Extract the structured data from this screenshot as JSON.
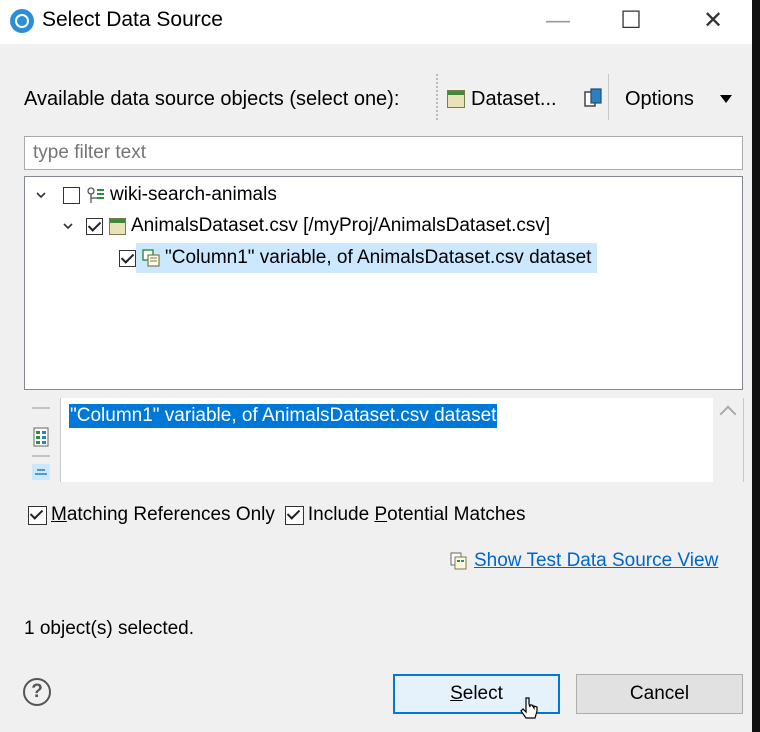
{
  "window": {
    "title": "Select Data Source",
    "minimize_label": "—",
    "maximize_label": "☐",
    "close_label": "✕"
  },
  "toolbar": {
    "available_label": "Available data source objects (select one):",
    "dataset_button": "Dataset...",
    "options_label": "Options"
  },
  "filter": {
    "placeholder": "type filter text"
  },
  "tree": {
    "items": [
      {
        "label": "wiki-search-animals",
        "checked": false,
        "expanded": true,
        "icon": "test-project-icon"
      },
      {
        "label": "AnimalsDataset.csv [/myProj/AnimalsDataset.csv]",
        "checked": true,
        "expanded": true,
        "icon": "dataset-icon"
      },
      {
        "label": "\"Column1\" variable, of AnimalsDataset.csv dataset",
        "checked": true,
        "selected": true,
        "icon": "variable-icon"
      }
    ]
  },
  "detail": {
    "text": "\"Column1\" variable, of AnimalsDataset.csv dataset"
  },
  "options": {
    "matching_refs_prefix": "",
    "matching_refs_mnemonic": "M",
    "matching_refs_rest": "atching References Only",
    "potential_prefix": "Include ",
    "potential_mnemonic": "P",
    "potential_rest": "otential Matches"
  },
  "link": {
    "label": "Show Test Data Source View"
  },
  "status": {
    "text": "1 object(s) selected."
  },
  "buttons": {
    "help": "?",
    "select_mnemonic": "S",
    "select_rest": "elect",
    "cancel": "Cancel"
  },
  "colors": {
    "accent": "#0078d7",
    "selection": "#cce8ff",
    "link": "#0066cc"
  }
}
